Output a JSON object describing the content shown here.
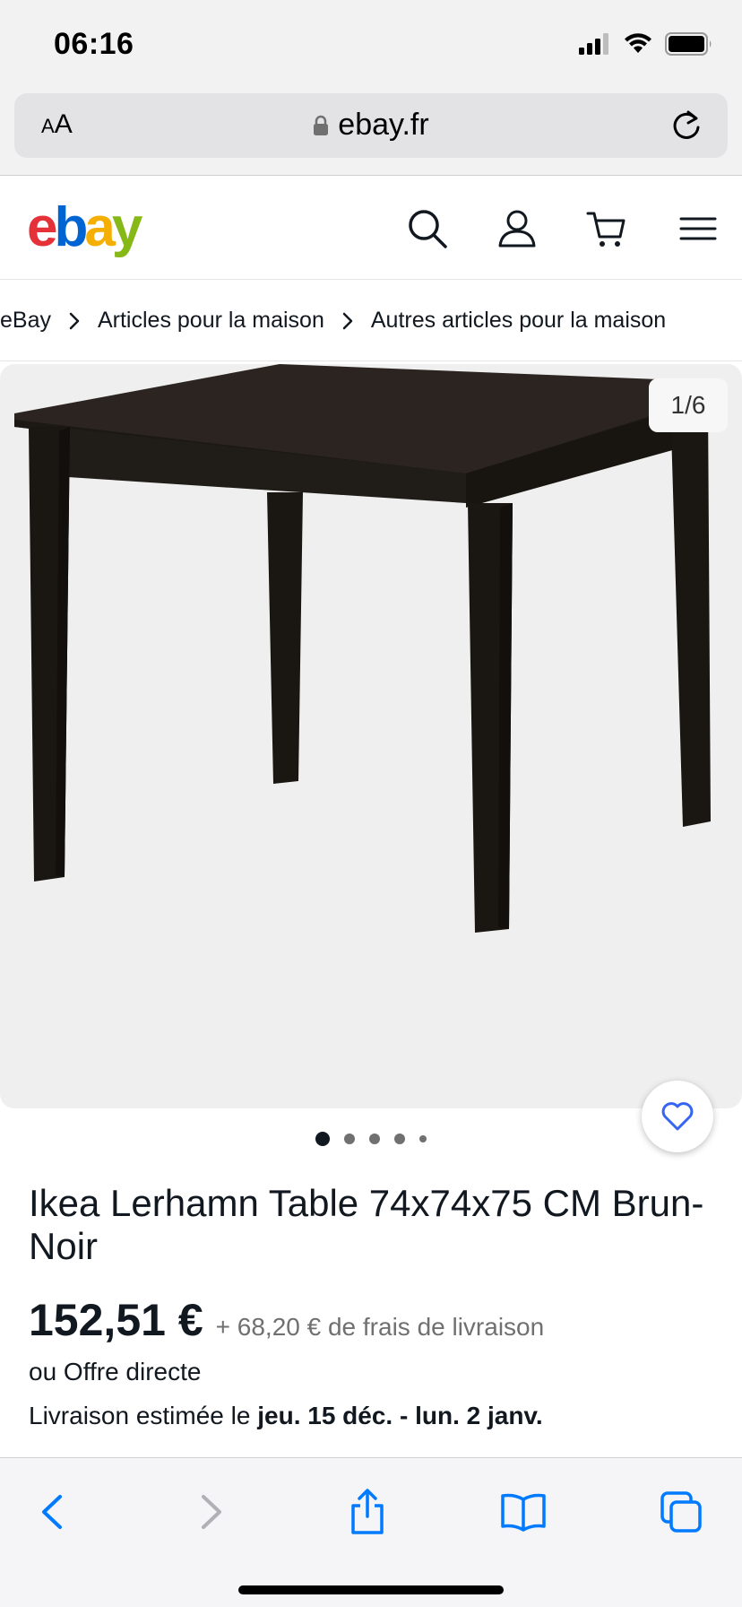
{
  "status_bar": {
    "time": "06:16"
  },
  "browser": {
    "text_size_label_small": "A",
    "text_size_label_large": "A",
    "url": "ebay.fr"
  },
  "header": {
    "logo": {
      "e": "e",
      "b": "b",
      "a": "a",
      "y": "y"
    },
    "icons": [
      "search-icon",
      "account-icon",
      "cart-icon",
      "menu-icon"
    ]
  },
  "breadcrumb": {
    "items": [
      "eBay",
      "Articles pour la maison",
      "Autres articles pour la maison"
    ]
  },
  "gallery": {
    "counter": "1/6",
    "total_images": 6,
    "current_index": 1
  },
  "listing": {
    "title": "Ikea Lerhamn Table 74x74x75 CM Brun-Noir",
    "price": "152,51 €",
    "shipping": "+ 68,20 € de frais de livraison",
    "offer": "ou Offre directe",
    "delivery_prefix": "Livraison estimée le ",
    "delivery_dates": "jeu. 15 déc. - lun. 2 janv."
  },
  "colors": {
    "accent_blue": "#3665f3",
    "safari_blue": "#007aff",
    "text_primary": "#111820",
    "text_secondary": "#707070"
  }
}
